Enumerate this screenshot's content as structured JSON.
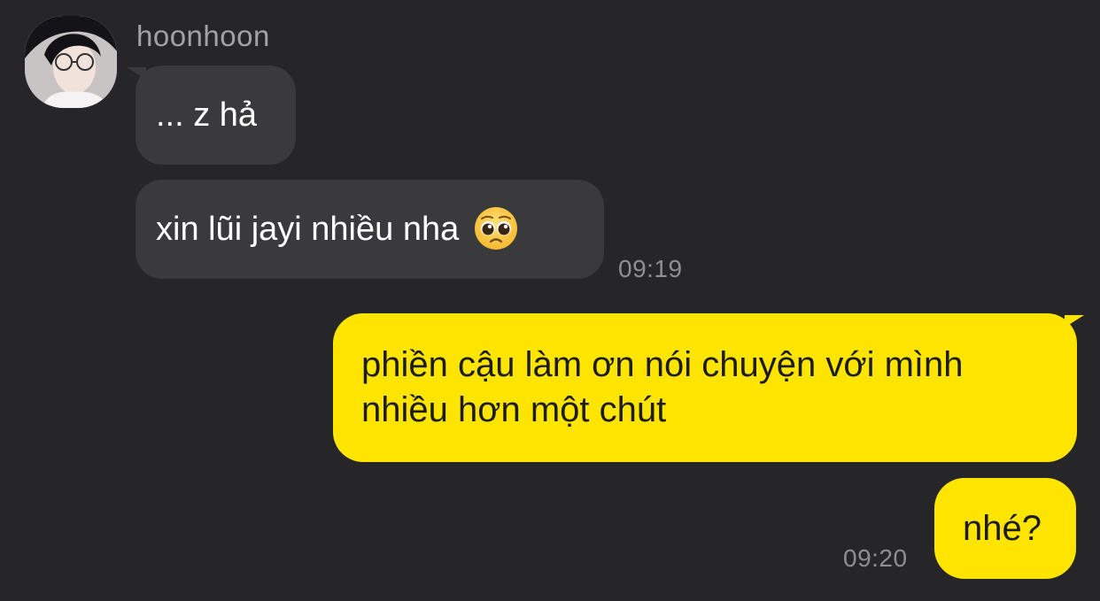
{
  "chat": {
    "sender": {
      "name": "hoonhoon"
    },
    "messages": [
      {
        "direction": "incoming",
        "text": "... z hả"
      },
      {
        "direction": "incoming",
        "text": "xin lũi jayi nhiều nha",
        "emoji": "pleading-face-icon"
      }
    ],
    "incoming_time": "09:19",
    "outgoing": [
      {
        "direction": "outgoing",
        "line1": "phiền cậu làm ơn nói chuyện với mình",
        "line2": "nhiều hơn một chút"
      },
      {
        "direction": "outgoing",
        "text": "nhé?"
      }
    ],
    "outgoing_time": "09:20"
  },
  "colors": {
    "background": "#262628",
    "incoming_bubble": "#3a3a3d",
    "outgoing_bubble": "#fee500",
    "timestamp": "#8e8e93"
  }
}
